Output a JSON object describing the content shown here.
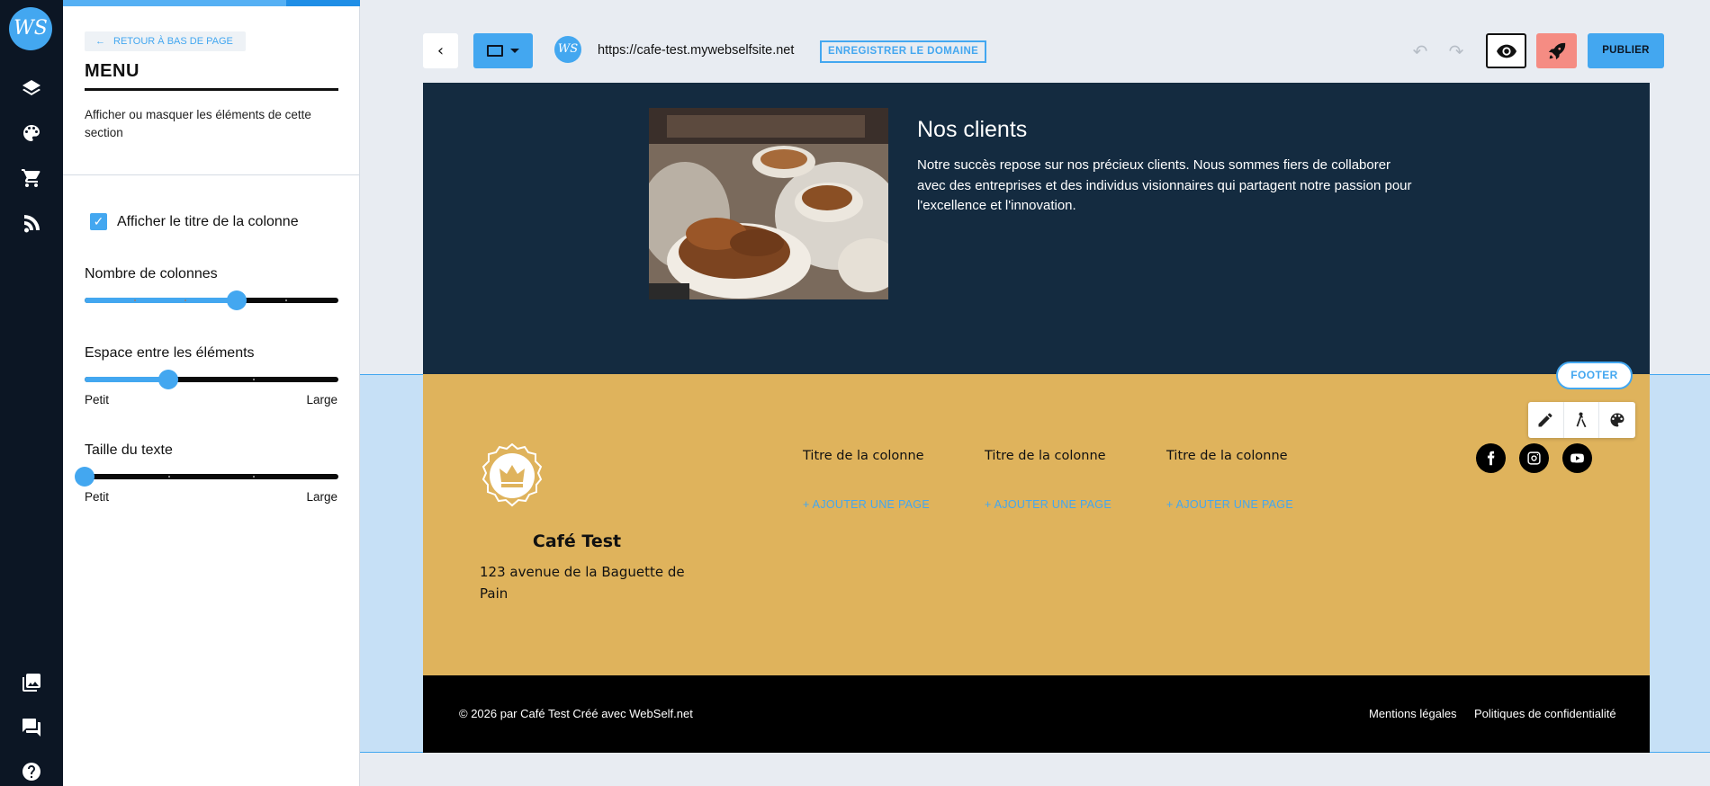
{
  "app": {
    "logo_text": "WS"
  },
  "rail": {
    "items": [
      {
        "icon": "layers-icon"
      },
      {
        "icon": "palette-icon"
      },
      {
        "icon": "cart-icon"
      },
      {
        "icon": "blog-icon"
      },
      {
        "icon": "images-icon"
      },
      {
        "icon": "chat-icon"
      },
      {
        "icon": "help-icon"
      }
    ]
  },
  "panel": {
    "back_label": "RETOUR À BAS DE PAGE",
    "title": "MENU",
    "description": "Afficher ou masquer les éléments de cette section",
    "checkbox_label": "Afficher le titre de la colonne",
    "checkbox_checked": true,
    "sliders": [
      {
        "label": "Nombre de colonnes",
        "value": 0.6,
        "min_label": "",
        "max_label": ""
      },
      {
        "label": "Espace entre les éléments",
        "value": 0.33,
        "min_label": "Petit",
        "max_label": "Large"
      },
      {
        "label": "Taille du texte",
        "value": 0.0,
        "min_label": "Petit",
        "max_label": "Large"
      }
    ]
  },
  "toolbar": {
    "back_icon": "chevron-left-icon",
    "device_icon": "desktop-icon",
    "site_logo_text": "WS",
    "url": "https://cafe-test.mywebselfsite.net",
    "domain_button": "ENREGISTRER LE DOMAINE",
    "publish_label": "PUBLIER"
  },
  "clients": {
    "heading": "Nos clients",
    "text": "Notre succès repose sur nos précieux clients. Nous sommes fiers de collaborer avec des entreprises et des individus visionnaires qui partagent notre passion pour l'excellence et l'innovation."
  },
  "footer": {
    "tag": "FOOTER",
    "name": "Café Test",
    "address": "123 avenue de la Baguette de Pain",
    "columns": [
      {
        "title": "Titre de la colonne",
        "add_label": "+ AJOUTER UNE PAGE"
      },
      {
        "title": "Titre de la colonne",
        "add_label": "+ AJOUTER UNE PAGE"
      },
      {
        "title": "Titre de la colonne",
        "add_label": "+ AJOUTER UNE PAGE"
      }
    ],
    "social": [
      "facebook-icon",
      "instagram-icon",
      "youtube-icon"
    ]
  },
  "bottom": {
    "copyright": "© 2026 par Café Test Créé avec WebSelf.net",
    "links": [
      "Mentions légales",
      "Politiques de confidentialité"
    ]
  },
  "colors": {
    "accent": "#43a7f0",
    "rail": "#0c1624",
    "clients_bg": "#142b40",
    "footer_bg": "#dfb35c",
    "rocket": "#f58c83"
  }
}
